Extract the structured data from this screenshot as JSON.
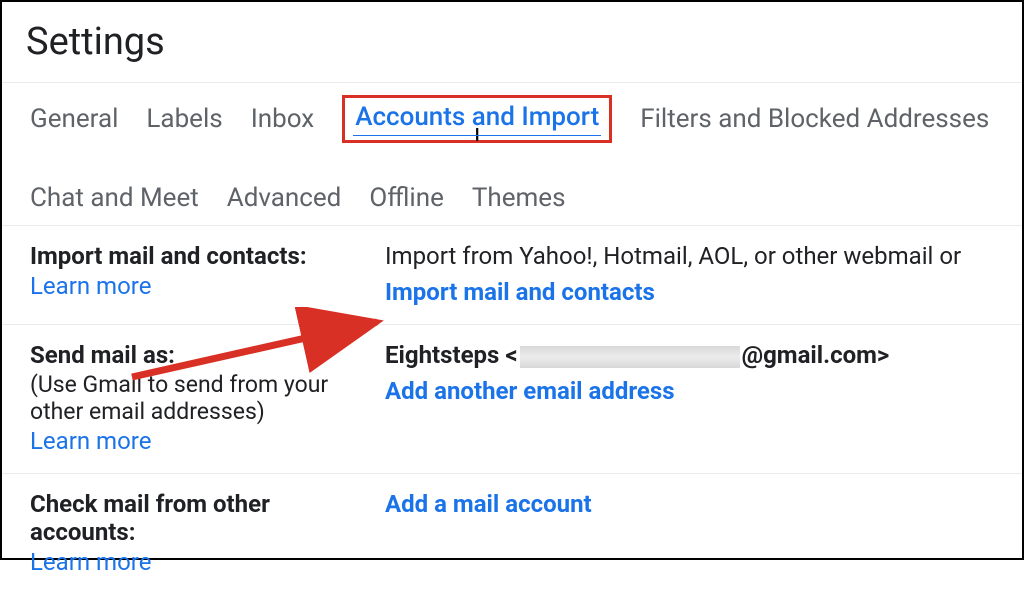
{
  "title": "Settings",
  "tabs": {
    "general": "General",
    "labels": "Labels",
    "inbox": "Inbox",
    "accounts": "Accounts and Import",
    "filters": "Filters and Blocked Addresses",
    "chat": "Chat and Meet",
    "advanced": "Advanced",
    "offline": "Offline",
    "themes": "Themes"
  },
  "sections": {
    "import": {
      "title": "Import mail and contacts:",
      "learn": "Learn more",
      "desc": "Import from Yahoo!, Hotmail, AOL, or other webmail or",
      "action": "Import mail and contacts"
    },
    "sendAs": {
      "title": "Send mail as:",
      "sub": "(Use Gmail to send from your other email addresses)",
      "learn": "Learn more",
      "namePrefix": "Eightsteps <",
      "nameSuffix": "@gmail.com>",
      "action": "Add another email address"
    },
    "checkMail": {
      "title": "Check mail from other accounts:",
      "learn": "Learn more",
      "action": "Add a mail account"
    }
  }
}
